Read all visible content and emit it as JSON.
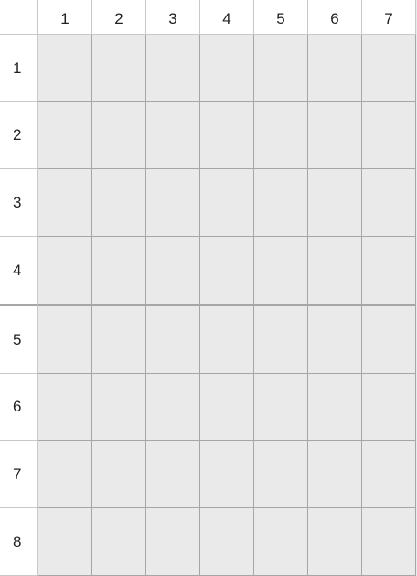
{
  "grid": {
    "column_headers": [
      "1",
      "2",
      "3",
      "4",
      "5",
      "6",
      "7"
    ],
    "row_headers": [
      "1",
      "2",
      "3",
      "4",
      "5",
      "6",
      "7",
      "8"
    ],
    "section_divider_after_row": 4,
    "colors": {
      "cell_background": "#eaeaea",
      "header_background": "#ffffff",
      "grid_line": "#a6a6a6",
      "text": "#222222"
    }
  }
}
